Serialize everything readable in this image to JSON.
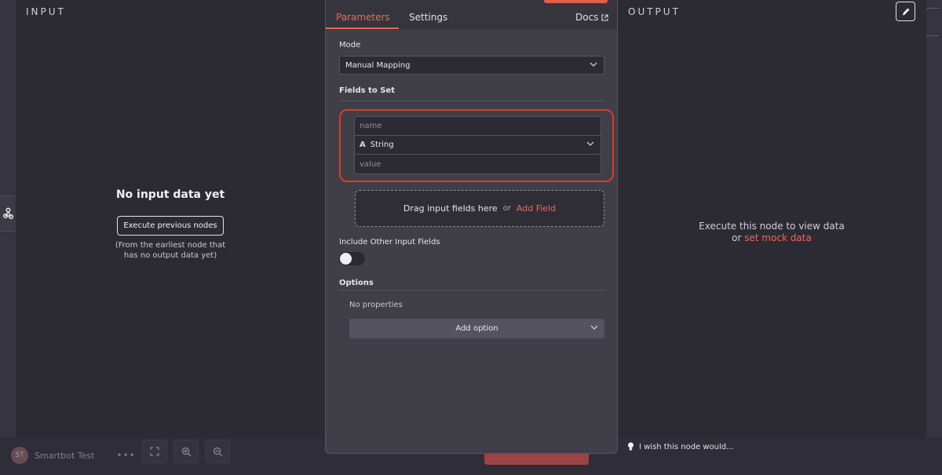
{
  "input_panel": {
    "title": "INPUT",
    "empty_title": "No input data yet",
    "execute_button": "Execute previous nodes",
    "note": "(From the earliest node that has no output data yet)"
  },
  "output_panel": {
    "title": "OUTPUT",
    "message": "Execute this node to view data",
    "or_text": "or",
    "mock_link": "set mock data"
  },
  "tabs": {
    "parameters": "Parameters",
    "settings": "Settings",
    "docs": "Docs"
  },
  "mode": {
    "label": "Mode",
    "value": "Manual Mapping"
  },
  "fields": {
    "label": "Fields to Set",
    "name_placeholder": "name",
    "type_icon": "A",
    "type_value": "String",
    "value_placeholder": "value"
  },
  "drop_zone": {
    "text": "Drag input fields here",
    "or_text": "or",
    "add_field": "Add Field"
  },
  "include_other": {
    "label": "Include Other Input Fields",
    "enabled": false
  },
  "options": {
    "label": "Options",
    "empty": "No properties",
    "add_option": "Add option"
  },
  "footer": {
    "user_initials": "ST",
    "user_name": "Smartbot Test",
    "dots": "•••",
    "wish": "I wish this node would..."
  },
  "colors": {
    "accent": "#ea6a5a",
    "highlight_border": "#e03a2a"
  }
}
